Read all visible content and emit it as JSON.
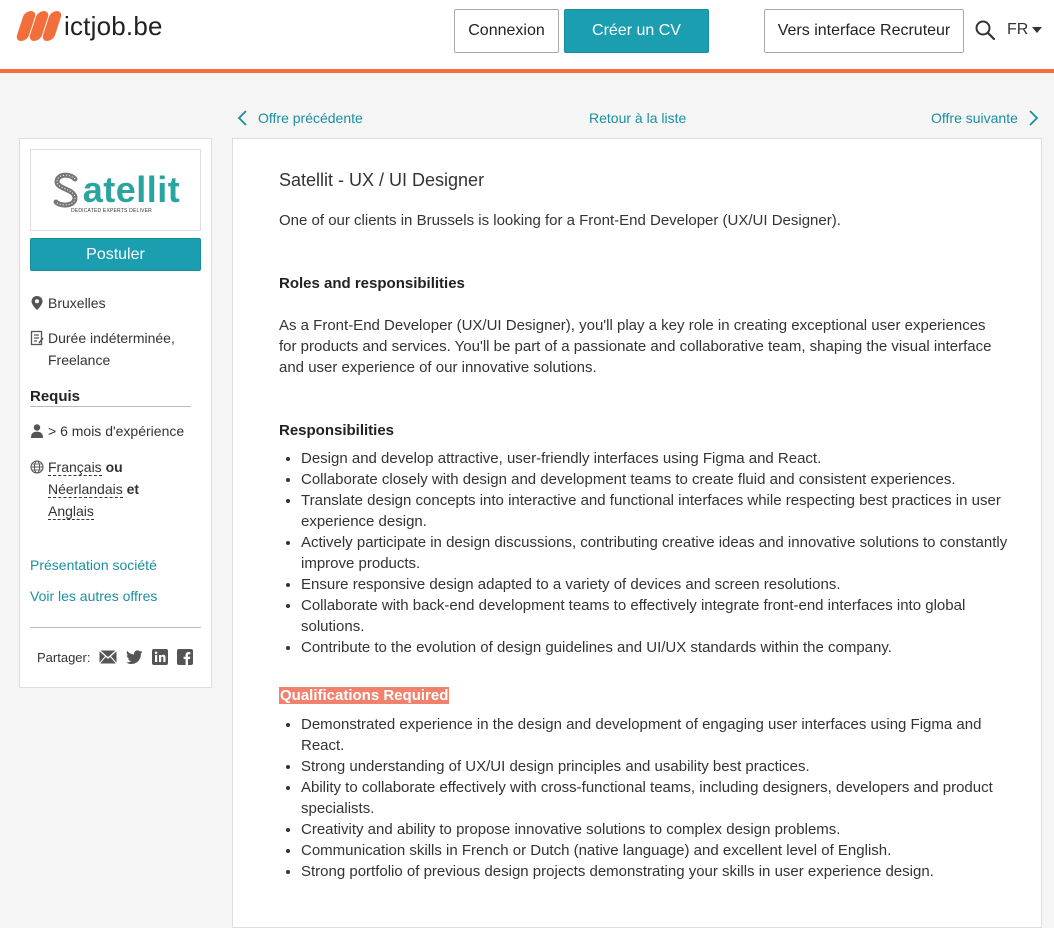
{
  "header": {
    "logo_text": "ictjob.be",
    "login_label": "Connexion",
    "create_cv_label": "Créer un CV",
    "recruiter_label": "Vers interface Recruteur",
    "lang_label": "FR",
    "accent_color": "#f26f3c",
    "primary_color": "#1b9fb0"
  },
  "nav": {
    "prev_label": "Offre précédente",
    "back_label": "Retour à la liste",
    "next_label": "Offre suivante"
  },
  "sidebar": {
    "company_logo_text": "atellit",
    "company_logo_tagline": "DEDICATED EXPERTS DELIVER",
    "apply_label": "Postuler",
    "location": "Bruxelles",
    "contract_line1": "Durée indéterminée,",
    "contract_line2": "Freelance",
    "requis_heading": "Requis",
    "experience": "> 6 mois d'expérience",
    "lang1": "Français",
    "or_label": "ou",
    "lang2": "Néerlandais",
    "and_label": "et",
    "lang3": "Anglais",
    "company_link": "Présentation société",
    "other_offers_link": "Voir les autres offres",
    "share_label": "Partager:"
  },
  "job": {
    "title": "Satellit - UX / UI Designer",
    "intro": "One of our clients in Brussels is looking for a Front-End Developer (UX/UI Designer).",
    "roles_heading": "Roles and responsibilities",
    "roles_text": "As a Front-End Developer (UX/UI Designer), you'll play a key role in creating exceptional user experiences for products and services. You'll be part of a passionate and collaborative team, shaping the visual interface and user experience of our innovative solutions.",
    "resp_heading": "Responsibilities",
    "responsibilities": [
      "Design and develop attractive, user-friendly interfaces using Figma and React.",
      "Collaborate closely with design and development teams to create fluid and consistent experiences.",
      "Translate design concepts into interactive and functional interfaces while respecting best practices in user experience design.",
      "Actively participate in design discussions, contributing creative ideas and innovative solutions to constantly improve products.",
      "Ensure responsive design adapted to a variety of devices and screen resolutions.",
      "Collaborate with back-end development teams to effectively integrate front-end interfaces into global solutions.",
      "Contribute to the evolution of design guidelines and UI/UX standards within the company."
    ],
    "qual_heading": "Qualifications Required",
    "qualifications": [
      "Demonstrated experience in the design and development of engaging user interfaces using Figma and React.",
      "Strong understanding of UX/UI design principles and usability best practices.",
      "Ability to collaborate effectively with cross-functional teams, including designers, developers and product specialists.",
      "Creativity and ability to propose innovative solutions to complex design problems.",
      "Communication skills in French or Dutch (native language) and excellent level of English.",
      "Strong portfolio of previous design projects demonstrating your skills in user experience design."
    ]
  }
}
